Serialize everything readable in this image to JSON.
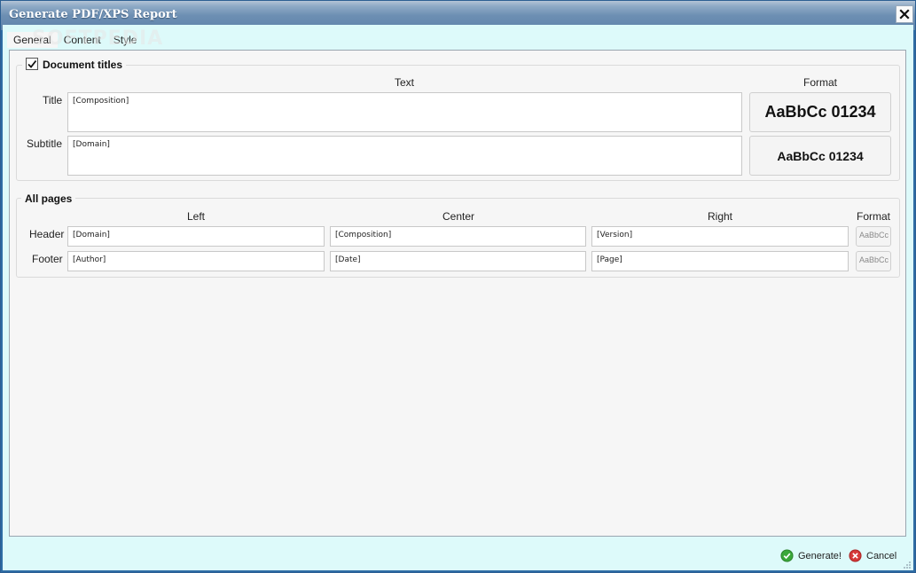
{
  "window": {
    "title": "Generate PDF/XPS Report"
  },
  "watermark": "SOFTPEDIA",
  "tabs": [
    {
      "label": "General"
    },
    {
      "label": "Content"
    },
    {
      "label": "Style"
    }
  ],
  "document_titles": {
    "checkbox_label": "Document titles",
    "checked": true,
    "col_text": "Text",
    "col_format": "Format",
    "rows": [
      {
        "label": "Title",
        "value": "[Composition]",
        "format_sample": "AaBbCc 01234"
      },
      {
        "label": "Subtitle",
        "value": "[Domain]",
        "format_sample": "AaBbCc 01234"
      }
    ]
  },
  "all_pages": {
    "header": "All pages",
    "col_left": "Left",
    "col_center": "Center",
    "col_right": "Right",
    "col_format": "Format",
    "rows": [
      {
        "label": "Header",
        "left": "[Domain]",
        "center": "[Composition]",
        "right": "[Version]",
        "format_sample": "AaBbCc"
      },
      {
        "label": "Footer",
        "left": "[Author]",
        "center": "[Date]",
        "right": "[Page]",
        "format_sample": "AaBbCc"
      }
    ]
  },
  "buttons": {
    "generate": "Generate!",
    "cancel": "Cancel"
  },
  "colors": {
    "titlebar": "#6d8fb3",
    "client_bg": "#ddfafa",
    "panel_bg": "#f6f6f6",
    "generate_icon": "#3aa83a",
    "cancel_icon": "#d63a3a"
  }
}
